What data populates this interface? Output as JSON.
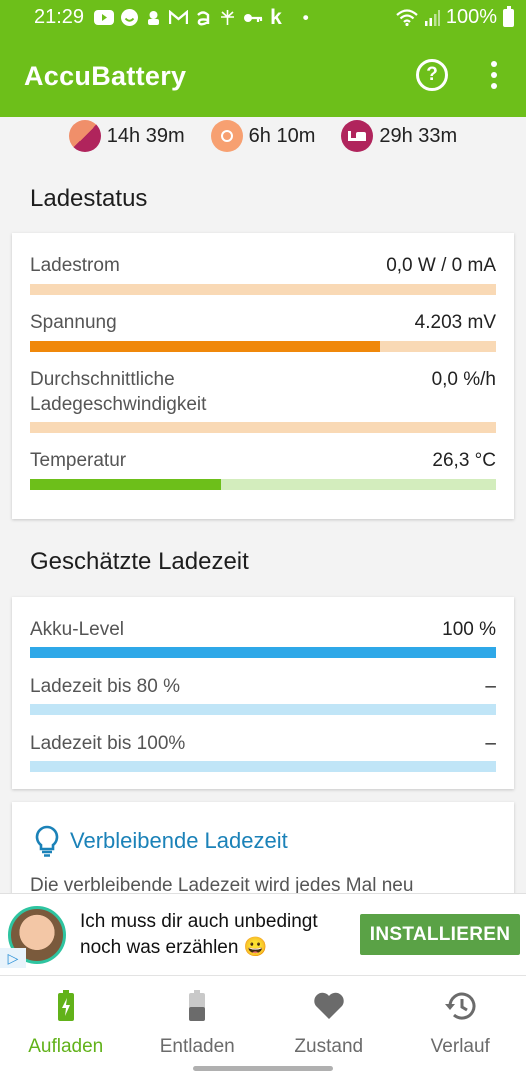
{
  "status_bar": {
    "time": "21:29",
    "notification_icons": [
      "youtube-icon",
      "emoji-icon",
      "app-icon",
      "gmail-icon",
      "amazon-icon",
      "dandelion-icon",
      "key-icon",
      "k"
    ],
    "dot": "•",
    "battery_percent": "100%"
  },
  "app_bar": {
    "title": "AccuBattery",
    "help_icon": "?"
  },
  "summary": [
    {
      "icon": "mixed-usage-icon",
      "value": "14h 39m",
      "color": "#b0245c"
    },
    {
      "icon": "sun-icon",
      "value": "6h 10m",
      "color": "#f7a071"
    },
    {
      "icon": "bed-icon",
      "value": "29h 33m",
      "color": "#b0245c"
    }
  ],
  "charge_status": {
    "title": "Ladestatus",
    "rows": [
      {
        "label": "Ladestrom",
        "value": "0,0 W / 0 mA",
        "fill": 0.0,
        "fill_color": "#f0880a",
        "track_color": "#f9d9b5"
      },
      {
        "label": "Spannung",
        "value": "4.203 mV",
        "fill": 0.75,
        "fill_color": "#f0880a",
        "track_color": "#f9d9b5"
      },
      {
        "label": "Durchschnittliche Ladegeschwindigkeit",
        "value": "0,0 %/h",
        "fill": 0.0,
        "fill_color": "#f0880a",
        "track_color": "#f9d9b5"
      },
      {
        "label": "Temperatur",
        "value": "26,3 °C",
        "fill": 0.41,
        "fill_color": "#6dbf1a",
        "track_color": "#d3edbd"
      }
    ]
  },
  "estimated_time": {
    "title": "Geschätzte Ladezeit",
    "rows": [
      {
        "label": "Akku-Level",
        "value": "100 %",
        "fill": 1.0,
        "fill_color": "#2ea8e8",
        "track_color": "#c0e5f7"
      },
      {
        "label": "Ladezeit bis 80 %",
        "value": "–",
        "fill": 0.0,
        "fill_color": "#2ea8e8",
        "track_color": "#c0e5f7"
      },
      {
        "label": "Ladezeit bis 100%",
        "value": "–",
        "fill": 0.0,
        "fill_color": "#2ea8e8",
        "track_color": "#c0e5f7"
      }
    ]
  },
  "tip": {
    "title": "Verbleibende Ladezeit",
    "body": "Die verbleibende Ladezeit wird jedes Mal neu"
  },
  "ad": {
    "text": "Ich muss dir auch unbedingt noch was erzählen 😀",
    "button": "INSTALLIEREN",
    "badge": "▷"
  },
  "bottom_nav": [
    {
      "label": "Aufladen",
      "icon": "battery-charging-icon",
      "active": true
    },
    {
      "label": "Entladen",
      "icon": "battery-half-icon",
      "active": false
    },
    {
      "label": "Zustand",
      "icon": "heart-icon",
      "active": false
    },
    {
      "label": "Verlauf",
      "icon": "history-icon",
      "active": false
    }
  ]
}
